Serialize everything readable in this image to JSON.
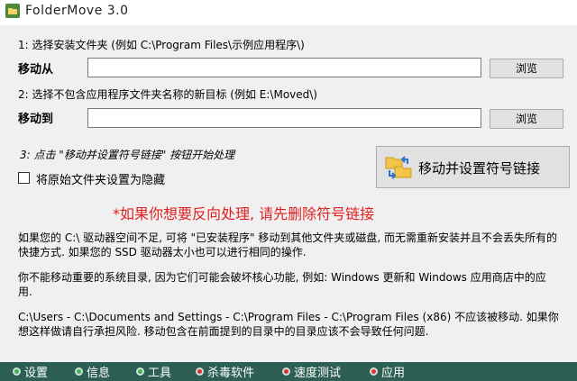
{
  "window": {
    "title": "FolderMove 3.0"
  },
  "step1": {
    "instruction": "1: 选择安装文件夹 (例如 C:\\Program Files\\示例应用程序\\)",
    "from_label": "移动从",
    "from_value": "",
    "browse_label": "浏览"
  },
  "step2": {
    "instruction": "2: 选择不包含应用程序文件夹名称的新目标 (例如 E:\\Moved\\)",
    "to_label": "移动到",
    "to_value": "",
    "browse_label": "浏览"
  },
  "step3": {
    "instruction": "3: 点击 \"移动并设置符号链接\" 按钮开始处理"
  },
  "hide_option": {
    "label": "将原始文件夹设置为隐藏",
    "checked": false
  },
  "main_button": {
    "label": "移动并设置符号链接",
    "icon": "folder-move-icon"
  },
  "warning": "*如果你想要反向处理, 请先删除符号链接",
  "info": {
    "p1": "如果您的 C:\\ 驱动器空间不足, 可将 \"已安装程序\" 移动到其他文件夹或磁盘, 而无需重新安装并且不会丢失所有的快捷方式. 如果您的 SSD 驱动器太小也可以进行相同的操作.",
    "p2": "你不能移动重要的系统目录, 因为它们可能会破坏核心功能, 例如: Windows 更新和 Windows 应用商店中的应用.",
    "p3": "C:\\Users - C:\\Documents and Settings - C:\\Program Files - C:\\Program Files (x86) 不应该被移动. 如果你想这样做请自行承担风险. 移动包含在前面提到的目录中的目录应该不会导致任何问题."
  },
  "tabs": [
    {
      "label": "设置",
      "dot": "green"
    },
    {
      "label": "信息",
      "dot": "green"
    },
    {
      "label": "工具",
      "dot": "green"
    },
    {
      "label": "杀毒软件",
      "dot": "red"
    },
    {
      "label": "速度测试",
      "dot": "red"
    },
    {
      "label": "应用",
      "dot": "red"
    }
  ],
  "colors": {
    "warning": "#e02020",
    "bottom_bar": "#2d5f53"
  }
}
